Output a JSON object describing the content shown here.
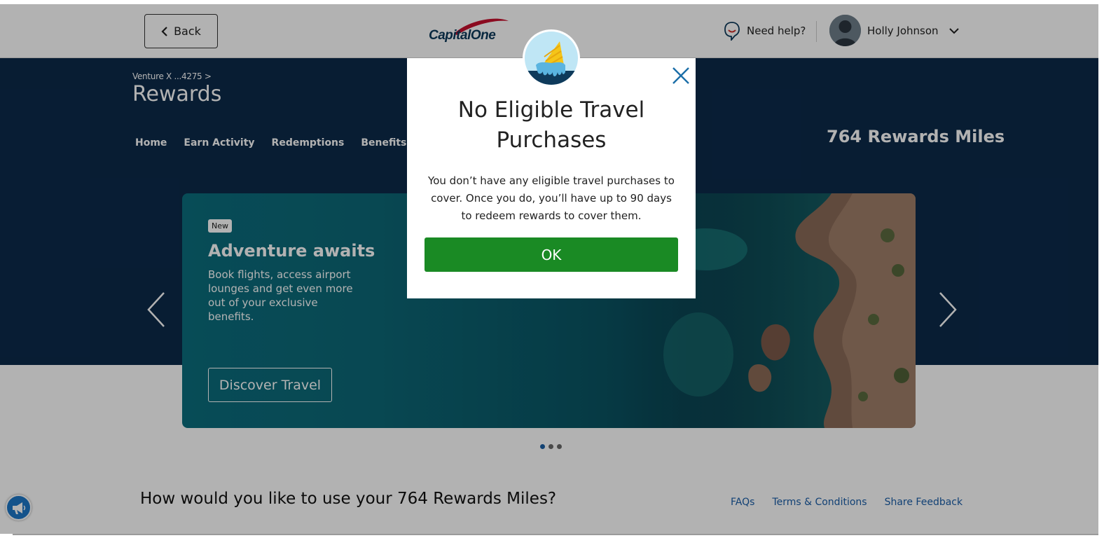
{
  "header": {
    "back_label": "Back",
    "logo_text": "CapitalOne",
    "help_label": "Need help?",
    "user_name": "Holly Johnson"
  },
  "hero": {
    "breadcrumb": "Venture X ...4275 >",
    "title": "Rewards",
    "nav": [
      "Home",
      "Earn Activity",
      "Redemptions",
      "Benefits"
    ],
    "miles_summary": "764 Rewards Miles"
  },
  "carousel": {
    "badge": "New",
    "title": "Adventure awaits",
    "body": "Book flights, access airport lounges and get even more out of your exclusive benefits.",
    "cta": "Discover Travel",
    "slide_count": 3,
    "active_slide": 1
  },
  "main": {
    "use_heading": "How would you like to use your 764 Rewards Miles?",
    "links": [
      "FAQs",
      "Terms & Conditions",
      "Share Feedback"
    ]
  },
  "modal": {
    "icon": "melting-ice-cream-icon",
    "title": "No Eligible Travel Purchases",
    "message": "You don’t have any eligible travel purchases to cover. Once you do, you’ll have up to 90 days to redeem rewards to cover them.",
    "ok_label": "OK"
  },
  "colors": {
    "hero_bg": "#0c2a4a",
    "ok_green": "#1a8a24",
    "link_blue": "#1a5ea8",
    "close_blue": "#1b6ea8",
    "logo_red": "#c8102e",
    "logo_navy": "#0e3a5b"
  }
}
